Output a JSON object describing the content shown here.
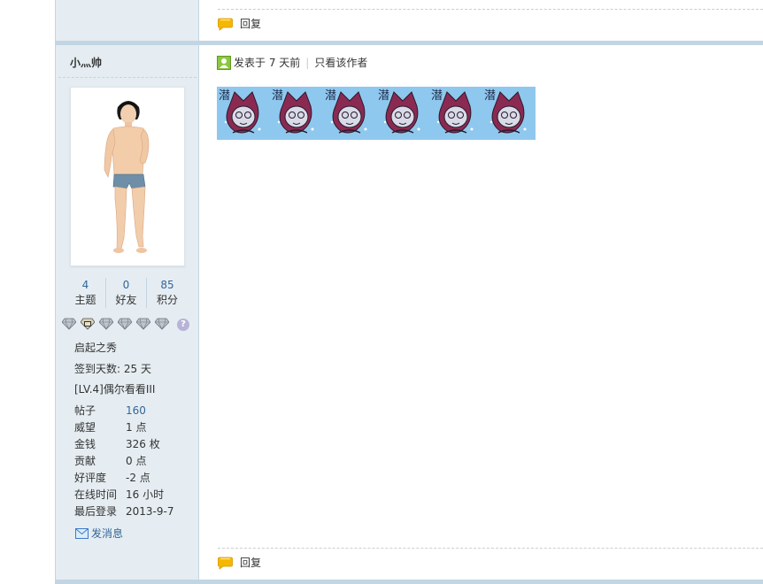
{
  "post_top": {
    "reply_label": "回复"
  },
  "author": {
    "username": "小灬帅",
    "stats": [
      {
        "value": "4",
        "label": "主题"
      },
      {
        "value": "0",
        "label": "好友"
      },
      {
        "value": "85",
        "label": "积分"
      }
    ],
    "medal_count": 6,
    "help_badge": "?",
    "rank_title": "启起之秀",
    "sign_days": "签到天数: 25 天",
    "level": "[LV.4]偶尔看看III",
    "info": [
      {
        "key": "帖子",
        "value": "160",
        "link": true
      },
      {
        "key": "威望",
        "value": "1 点"
      },
      {
        "key": "金钱",
        "value": "326 枚"
      },
      {
        "key": "贡献",
        "value": "0 点"
      },
      {
        "key": "好评度",
        "value": "-2 点"
      },
      {
        "key": "在线时间",
        "value": "16 小时"
      },
      {
        "key": "最后登录",
        "value": "2013-9-7"
      }
    ],
    "send_message": "发消息"
  },
  "post": {
    "posted_at": "发表于 7 天前",
    "only_author": "只看该作者",
    "emoticon_text": "潜",
    "emoticon_count": 6,
    "reply_label": "回复"
  },
  "colors": {
    "sidebar_bg": "#e5edf2",
    "border": "#c2d5e3",
    "link": "#336699",
    "emoticon_bg": "#8fc8ee"
  }
}
